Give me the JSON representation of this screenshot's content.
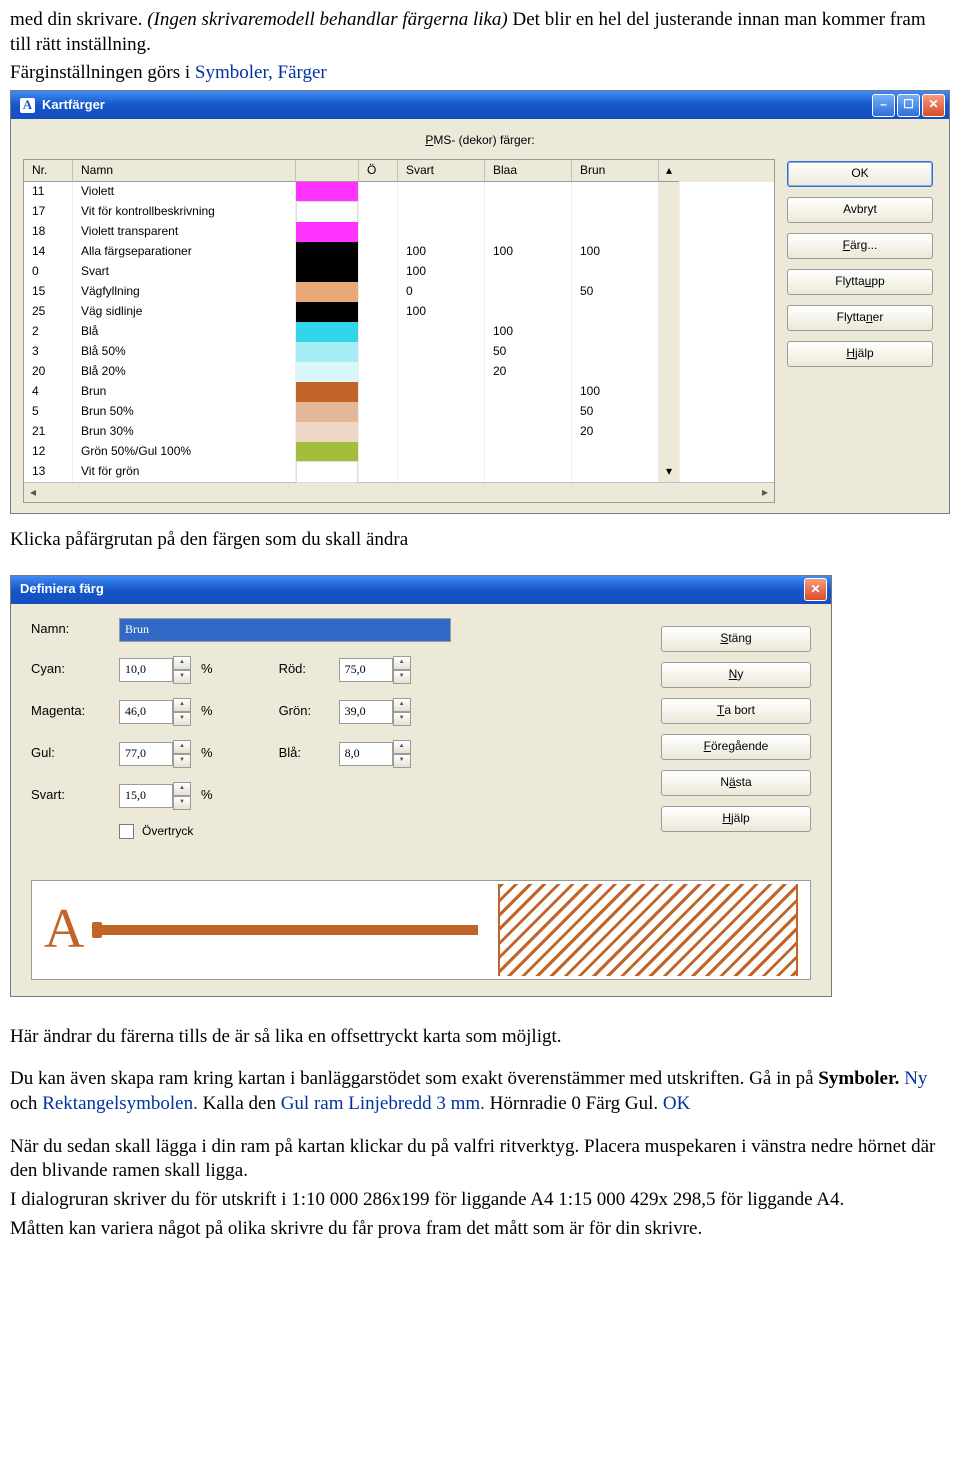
{
  "doc": {
    "p1a": "med din skrivare. ",
    "p1b": "(Ingen skrivaremodell behandlar färgerna lika)",
    "p1c": " Det blir en hel del justerande innan man kommer fram till rätt inställning.",
    "p2a": "Färginställningen görs i ",
    "p2b": "Symboler, Färger",
    "p3": "Klicka påfärgrutan på den  färgen som du skall ändra",
    "p4": "Här ändrar du färerna tills de är så lika en offsettryckt karta som möjligt.",
    "p5a": "Du kan även skapa ram kring kartan i banläggarstödet som exakt överenstämmer med utskriften. Gå in på ",
    "p5b": "Symboler. ",
    "p5c": "Ny ",
    "p5d": "och ",
    "p5e": "Rektangelsymbolen.",
    "p5f": " Kalla den ",
    "p5g": "Gul ram Linjebredd 3 mm.",
    "p5h": " Hörnradie 0 Färg Gul. ",
    "p5i": "OK",
    "p6": "När du sedan skall lägga i din ram på kartan klickar du på valfri ritverktyg. Placera muspekaren i vänstra nedre hörnet där den blivande ramen skall ligga.",
    "p7": "I dialogruran skriver du för utskrift i 1:10 000 286x199 för liggande A4 1:15 000 429x 298,5 för liggande A4.",
    "p8": "Måtten kan variera något på olika skrivre du får prova fram det mått som är för din skrivre."
  },
  "kf": {
    "title": "Kartfärger",
    "pms": "PMS- (dekor) färger:",
    "headers": {
      "nr": "Nr.",
      "namn": "Namn",
      "o": "Ö",
      "svart": "Svart",
      "blaa": "Blaa",
      "brun": "Brun"
    },
    "buttons": {
      "ok": "OK",
      "avbryt": "Avbryt",
      "farg": "Färg...",
      "upp": "Flytta upp",
      "ner": "Flytta ner",
      "hjalp": "Hjälp"
    },
    "rows": [
      {
        "nr": "11",
        "namn": "Violett",
        "hex": "#ff33ff",
        "svart": "",
        "blaa": "",
        "brun": ""
      },
      {
        "nr": "17",
        "namn": "Vit för kontrollbeskrivning",
        "hex": "#ffffff",
        "svart": "",
        "blaa": "",
        "brun": ""
      },
      {
        "nr": "18",
        "namn": "Violett transparent",
        "hex": "#ff33ff",
        "svart": "",
        "blaa": "",
        "brun": ""
      },
      {
        "nr": "14",
        "namn": "Alla färgseparationer",
        "hex": "#000000",
        "svart": "100",
        "blaa": "100",
        "brun": "100"
      },
      {
        "nr": "0",
        "namn": "Svart",
        "hex": "#000000",
        "svart": "100",
        "blaa": "",
        "brun": ""
      },
      {
        "nr": "15",
        "namn": "Vägfyllning",
        "hex": "#e8a878",
        "svart": "0",
        "blaa": "",
        "brun": "50"
      },
      {
        "nr": "25",
        "namn": "Väg sidlinje",
        "hex": "#000000",
        "svart": "100",
        "blaa": "",
        "brun": ""
      },
      {
        "nr": "2",
        "namn": "Blå",
        "hex": "#33d6e8",
        "svart": "",
        "blaa": "100",
        "brun": ""
      },
      {
        "nr": "3",
        "namn": "Blå 50%",
        "hex": "#a6ecf4",
        "svart": "",
        "blaa": "50",
        "brun": ""
      },
      {
        "nr": "20",
        "namn": "Blå 20%",
        "hex": "#d9f6fa",
        "svart": "",
        "blaa": "20",
        "brun": ""
      },
      {
        "nr": "4",
        "namn": "Brun",
        "hex": "#c06428",
        "svart": "",
        "blaa": "",
        "brun": "100"
      },
      {
        "nr": "5",
        "namn": "Brun 50%",
        "hex": "#e3b89a",
        "svart": "",
        "blaa": "",
        "brun": "50"
      },
      {
        "nr": "21",
        "namn": "Brun 30%",
        "hex": "#f0d6c4",
        "svart": "",
        "blaa": "",
        "brun": "20"
      },
      {
        "nr": "12",
        "namn": "Grön 50%/Gul 100%",
        "hex": "#a2be3c",
        "svart": "",
        "blaa": "",
        "brun": ""
      },
      {
        "nr": "13",
        "namn": "Vit för grön",
        "hex": "#ffffff",
        "svart": "",
        "blaa": "",
        "brun": ""
      }
    ]
  },
  "df": {
    "title": "Definiera färg",
    "labels": {
      "namn": "Namn:",
      "cyan": "Cyan:",
      "magenta": "Magenta:",
      "gul": "Gul:",
      "svart": "Svart:",
      "rod": "Röd:",
      "gron": "Grön:",
      "bla": "Blå:",
      "overtryck": "Övertryck"
    },
    "values": {
      "namn": "Brun",
      "cyan": "10,0",
      "magenta": "46,0",
      "gul": "77,0",
      "svart": "15,0",
      "rod": "75,0",
      "gron": "39,0",
      "bla": "8,0"
    },
    "buttons": {
      "stang": "Stäng",
      "ny": "Ny",
      "tabort": "Ta bort",
      "foreg": "Föregående",
      "nasta": "Nästa",
      "hjalp": "Hjälp"
    },
    "preview_a": "A"
  }
}
